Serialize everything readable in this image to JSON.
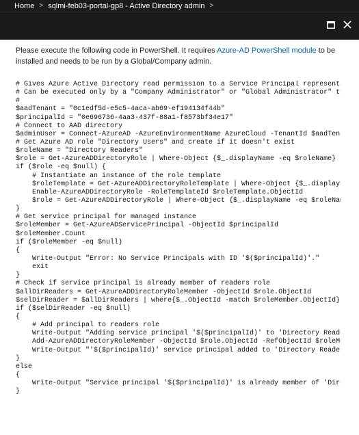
{
  "breadcrumb": {
    "items": [
      "Home",
      "sqlmi-feb03-portal-gp8 - Active Directory admin"
    ],
    "separator": ">"
  },
  "window": {
    "maximize_icon": "maximize-icon",
    "close_icon": "close-icon"
  },
  "intro": {
    "text_before": "Please execute the following code in PowerShell. It requires ",
    "link_text": "Azure-AD PowerShell module",
    "text_after": " to be installed and needs to be run by a Global/Company admin."
  },
  "code_lines": [
    "# Gives Azure Active Directory read permission to a Service Principal representin",
    "# Can be executed only by a \"Company Administrator\" or \"Global Administrator\" typ",
    "#",
    "$aadTenant = \"0c1edf5d-e5c5-4aca-ab69-ef194134f44b\"",
    "$principalId = \"0e696736-4aa3-437f-88a1-f8573bf34e17\"",
    "# Connect to AAD directory",
    "$adminUser = Connect-AzureAD -AzureEnvironmentName AzureCloud -TenantId $aadTenan",
    "# Get Azure AD role \"Directory Users\" and create if it doesn't exist",
    "$roleName = \"Directory Readers\"",
    "$role = Get-AzureADDirectoryRole | Where-Object {$_.displayName -eq $roleName}",
    "if ($role -eq $null) {",
    "    # Instantiate an instance of the role template",
    "    $roleTemplate = Get-AzureADDirectoryRoleTemplate | Where-Object {$_.displayNa",
    "    Enable-AzureADDirectoryRole -RoleTemplateId $roleTemplate.ObjectId",
    "    $role = Get-AzureADDirectoryRole | Where-Object {$_.displayName -eq $roleName",
    "}",
    "# Get service principal for managed instance",
    "$roleMember = Get-AzureADServicePrincipal -ObjectId $principalId",
    "$roleMember.Count",
    "if ($roleMember -eq $null)",
    "{",
    "    Write-Output \"Error: No Service Principals with ID '$($principalId)'.\"",
    "    exit",
    "}",
    "# Check if service principal is already member of readers role",
    "$allDirReaders = Get-AzureADDirectoryRoleMember -ObjectId $role.ObjectId",
    "$selDirReader = $allDirReaders | where{$_.ObjectId -match $roleMember.ObjectId}",
    "if ($selDirReader -eq $null)",
    "{",
    "    # Add principal to readers role",
    "    Write-Output \"Adding service principal '$($principalId)' to 'Directory Reader",
    "    Add-AzureADDirectoryRoleMember -ObjectId $role.ObjectId -RefObjectId $roleMem",
    "    Write-Output \"'$($principalId)' service principal added to 'Directory Readers",
    "}",
    "else",
    "{",
    "    Write-Output \"Service principal '$($principalId)' is already member of 'Direc",
    "}"
  ]
}
